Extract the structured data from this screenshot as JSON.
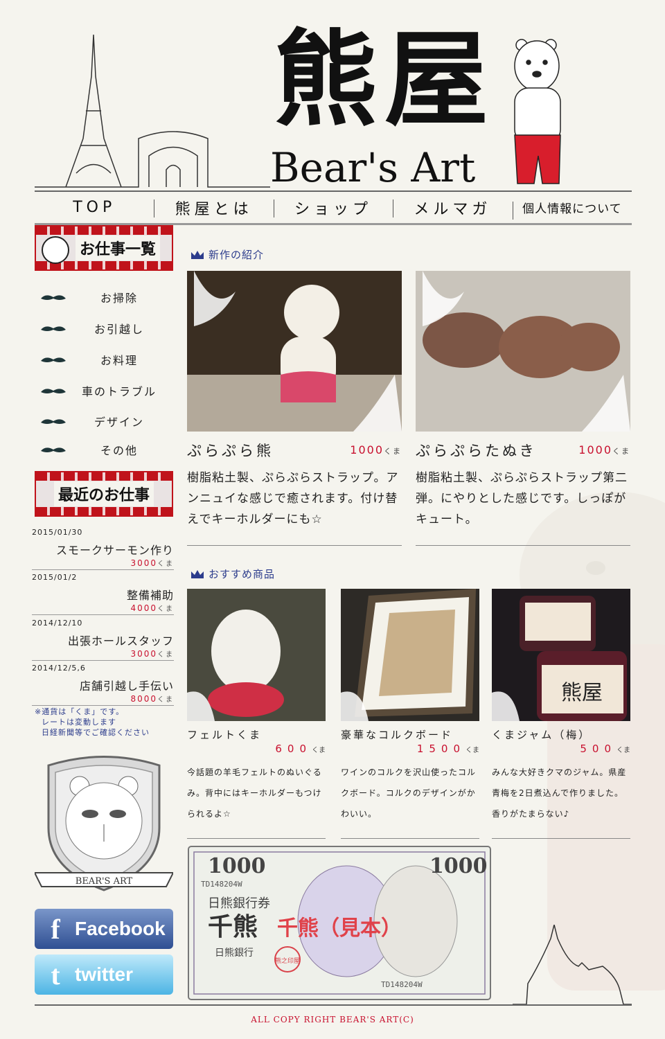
{
  "header": {
    "title_kanji": "熊屋",
    "title_en": "Bear's Art"
  },
  "nav": [
    "TOP",
    "熊屋とは",
    "ショップ",
    "メルマガ",
    "個人情報について"
  ],
  "sidebar": {
    "works_title": "お仕事一覧",
    "works": [
      "お掃除",
      "お引越し",
      "お料理",
      "車のトラブル",
      "デザイン",
      "その他"
    ],
    "recent_title": "最近のお仕事",
    "recent": [
      {
        "date": "2015/01/30",
        "name": "スモークサーモン作り",
        "price": "3000",
        "unit": "くま"
      },
      {
        "date": "2015/01/2",
        "name": "整備補助",
        "price": "4000",
        "unit": "くま"
      },
      {
        "date": "2014/12/10",
        "name": "出張ホールスタッフ",
        "price": "3000",
        "unit": "くま"
      },
      {
        "date": "2014/12/5,6",
        "name": "店舗引越し手伝い",
        "price": "8000",
        "unit": "くま"
      }
    ],
    "note": [
      "※通貨は「くま」です。",
      "レートは変動します",
      "日経新聞等でご確認ください"
    ],
    "emblem_text": "BEAR'S ART",
    "facebook_label": "Facebook",
    "twitter_label": "twitter"
  },
  "new_section": {
    "title": "新作の紹介",
    "products": [
      {
        "name": "ぷらぷら熊",
        "price": "1000",
        "unit": "くま",
        "desc": "樹脂粘土製、ぷらぷらストラップ。アンニュイな感じで癒されます。付け替えでキーホルダーにも☆"
      },
      {
        "name": "ぷらぷらたぬき",
        "price": "1000",
        "unit": "くま",
        "desc": "樹脂粘土製、ぷらぷらストラップ第二弾。にやりとした感じです。しっぽがキュート。"
      }
    ]
  },
  "recommend_section": {
    "title": "おすすめ商品",
    "products": [
      {
        "name": "フェルトくま",
        "price": "600",
        "unit": "くま",
        "desc": "今話題の羊毛フェルトのぬいぐるみ。背中にはキーホルダーもつけられるよ☆"
      },
      {
        "name": "豪華なコルクボード",
        "price": "1500",
        "unit": "くま",
        "desc": "ワインのコルクを沢山使ったコルクボード。コルクのデザインがかわいい。"
      },
      {
        "name": "くまジャム（梅）",
        "price": "500",
        "unit": "くま",
        "desc": "みんな大好きクマのジャム。県産青梅を2日煮込んで作りました。香りがたまらない♪"
      }
    ]
  },
  "banknote": {
    "value": "1000",
    "serial": "TD148204W",
    "bank": "日熊銀行券",
    "issuer": "日熊銀行",
    "name": "千熊",
    "sample_label": "千熊（見本）",
    "seal": "熊之印屋"
  },
  "jam_label": "熊屋",
  "footer": "ALL COPY RIGHT BEAR'S ART(C)",
  "colors": {
    "accent_red": "#c8102e",
    "accent_blue": "#2c3c8c",
    "facebook": "#3b5998",
    "twitter": "#55acee"
  }
}
